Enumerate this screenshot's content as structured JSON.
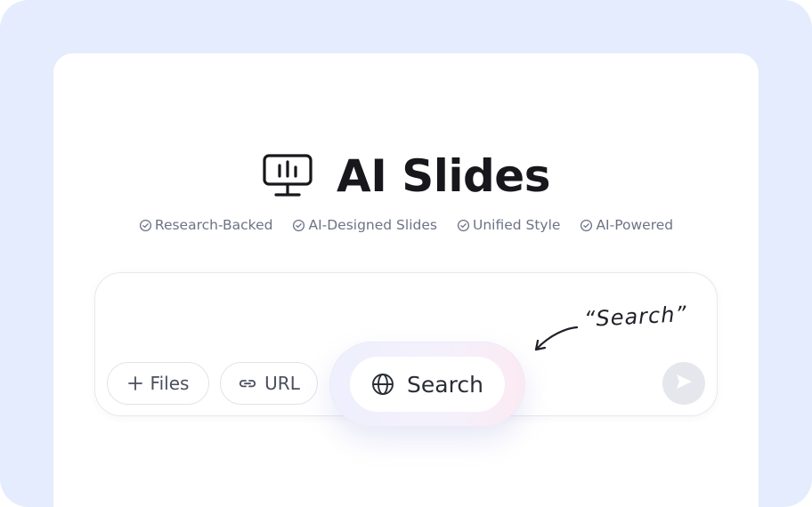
{
  "title": "AI Slides",
  "features": [
    {
      "label": "Research-Backed",
      "icon": "check-circle-icon"
    },
    {
      "label": "AI-Designed Slides",
      "icon": "check-circle-icon"
    },
    {
      "label": "Unified Style",
      "icon": "check-circle-icon"
    },
    {
      "label": "AI-Powered",
      "icon": "check-circle-icon"
    }
  ],
  "composer": {
    "files_label": "Files",
    "url_label": "URL",
    "search_label": "Search"
  },
  "callout_text": "“Search”",
  "colors": {
    "background": "#e4ecfd",
    "card": "#ffffff",
    "title": "#17171c",
    "feature_text": "#6e7385",
    "send_button": "#e6e7ec"
  }
}
